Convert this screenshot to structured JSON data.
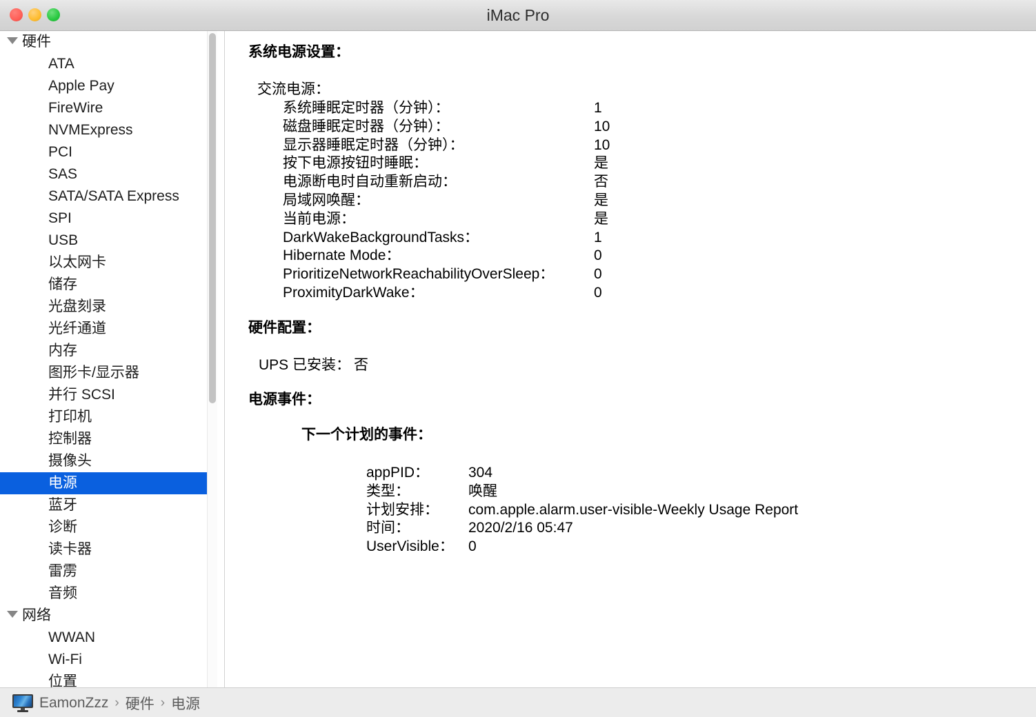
{
  "window": {
    "title": "iMac Pro",
    "traffic_lights": [
      {
        "name": "close",
        "color": "#FF5F57"
      },
      {
        "name": "minimize",
        "color": "#FEBC2E"
      },
      {
        "name": "maximize",
        "color": "#28C840"
      }
    ]
  },
  "sidebar": {
    "selected": "电源",
    "selection_color": "#0A60DF",
    "groups": [
      {
        "label": "硬件",
        "expanded": true,
        "items": [
          "ATA",
          "Apple Pay",
          "FireWire",
          "NVMExpress",
          "PCI",
          "SAS",
          "SATA/SATA Express",
          "SPI",
          "USB",
          "以太网卡",
          "储存",
          "光盘刻录",
          "光纤通道",
          "内存",
          "图形卡/显示器",
          "并行 SCSI",
          "打印机",
          "控制器",
          "摄像头",
          "电源",
          "蓝牙",
          "诊断",
          "读卡器",
          "雷雳",
          "音频"
        ]
      },
      {
        "label": "网络",
        "expanded": true,
        "items": [
          "WWAN",
          "Wi-Fi",
          "位置"
        ]
      }
    ]
  },
  "content": {
    "sections": [
      {
        "heading": "系统电源设置：",
        "subsection": "交流电源：",
        "rows": [
          {
            "label": "系统睡眠定时器（分钟）：",
            "value": "1"
          },
          {
            "label": "磁盘睡眠定时器（分钟）：",
            "value": "10"
          },
          {
            "label": "显示器睡眠定时器（分钟）：",
            "value": "10"
          },
          {
            "label": "按下电源按钮时睡眠：",
            "value": "是"
          },
          {
            "label": "电源断电时自动重新启动：",
            "value": "否"
          },
          {
            "label": "局域网唤醒：",
            "value": "是"
          },
          {
            "label": "当前电源：",
            "value": "是"
          },
          {
            "label": "DarkWakeBackgroundTasks：",
            "value": "1"
          },
          {
            "label": "Hibernate Mode：",
            "value": "0"
          },
          {
            "label": "PrioritizeNetworkReachabilityOverSleep：",
            "value": "0"
          },
          {
            "label": "ProximityDarkWake：",
            "value": "0"
          }
        ]
      },
      {
        "heading": "硬件配置：",
        "rows": [
          {
            "label": "UPS 已安装：",
            "value": "否"
          }
        ]
      },
      {
        "heading": "电源事件：",
        "subheading": "下一个计划的事件：",
        "rows": [
          {
            "label": "appPID：",
            "value": "304"
          },
          {
            "label": "类型：",
            "value": "唤醒"
          },
          {
            "label": "计划安排：",
            "value": "com.apple.alarm.user-visible-Weekly Usage Report"
          },
          {
            "label": "时间：",
            "value": "2020/2/16 05:47"
          },
          {
            "label": "UserVisible：",
            "value": "0"
          }
        ]
      }
    ]
  },
  "statusbar": {
    "icon": "imac-icon",
    "crumbs": [
      "EamonZzz",
      "硬件",
      "电源"
    ],
    "separator": "›"
  }
}
